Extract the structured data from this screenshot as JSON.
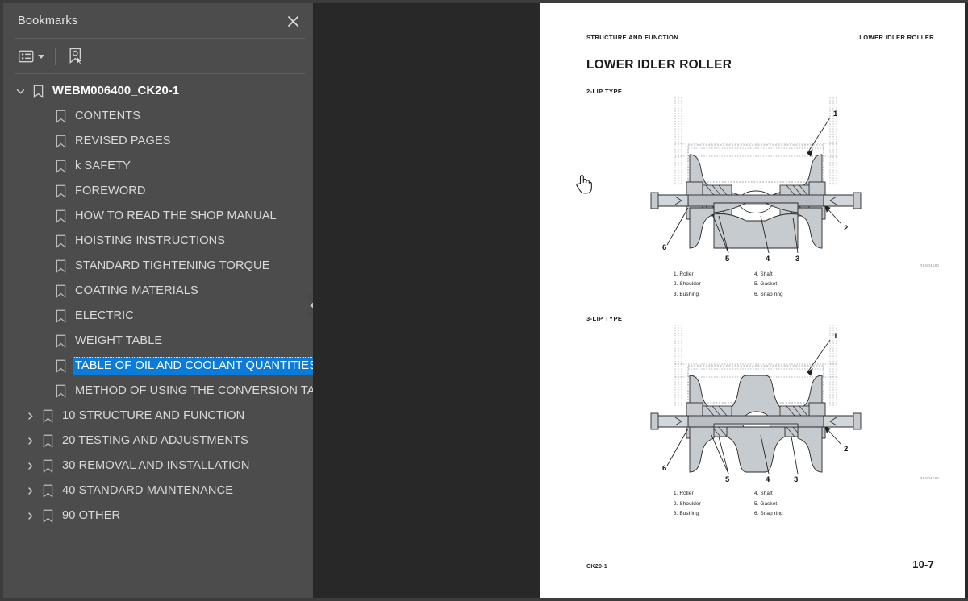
{
  "panel": {
    "title": "Bookmarks",
    "close_icon": "close-icon",
    "toolbar": {
      "options_icon": "list-options-icon",
      "options_caret": "chevron-down-icon",
      "new_bookmark_icon": "bookmark-pointer-icon"
    },
    "collapse_handle_icon": "triangle-left-icon",
    "tree": {
      "root": {
        "label": "WEBM006400_CK20-1",
        "expanded": true
      },
      "items": [
        {
          "label": "CONTENTS",
          "type": "leaf",
          "selected": false
        },
        {
          "label": "REVISED PAGES",
          "type": "leaf",
          "selected": false
        },
        {
          "label": "k SAFETY",
          "type": "leaf",
          "selected": false
        },
        {
          "label": "FOREWORD",
          "type": "leaf",
          "selected": false
        },
        {
          "label": "HOW TO READ THE SHOP MANUAL",
          "type": "leaf",
          "selected": false
        },
        {
          "label": "HOISTING INSTRUCTIONS",
          "type": "leaf",
          "selected": false
        },
        {
          "label": "STANDARD TIGHTENING TORQUE",
          "type": "leaf",
          "selected": false
        },
        {
          "label": "COATING MATERIALS",
          "type": "leaf",
          "selected": false
        },
        {
          "label": "ELECTRIC",
          "type": "leaf",
          "selected": false
        },
        {
          "label": "WEIGHT TABLE",
          "type": "leaf",
          "selected": false
        },
        {
          "label": "TABLE OF OIL AND COOLANT QUANTITIES",
          "type": "leaf",
          "selected": true
        },
        {
          "label": "METHOD OF USING THE CONVERSION TABLE",
          "type": "leaf",
          "selected": false
        },
        {
          "label": "10 STRUCTURE AND FUNCTION",
          "type": "group",
          "selected": false
        },
        {
          "label": "20 TESTING AND ADJUSTMENTS",
          "type": "group",
          "selected": false
        },
        {
          "label": "30 REMOVAL AND INSTALLATION",
          "type": "group",
          "selected": false
        },
        {
          "label": "40 STANDARD MAINTENANCE",
          "type": "group",
          "selected": false
        },
        {
          "label": "90 OTHER",
          "type": "group",
          "selected": false
        }
      ]
    }
  },
  "document": {
    "running_head_left": "STRUCTURE AND FUNCTION",
    "running_head_right": "LOWER IDLER ROLLER",
    "heading": "LOWER IDLER ROLLER",
    "figures": [
      {
        "type_label": "2-LIP TYPE",
        "drawing_code": "RKS04180",
        "callouts": [
          "1",
          "2",
          "3",
          "4",
          "5",
          "6"
        ],
        "legend_left": [
          "1. Roller",
          "2. Shoulder",
          "3. Bushing"
        ],
        "legend_right": [
          "4. Shaft",
          "5. Gasket",
          "6. Snap ring"
        ]
      },
      {
        "type_label": "3-LIP TYPE",
        "drawing_code": "RKS04190",
        "callouts": [
          "1",
          "2",
          "3",
          "4",
          "5",
          "6"
        ],
        "legend_left": [
          "1. Roller",
          "2. Shoulder",
          "3. Bushing"
        ],
        "legend_right": [
          "4. Shaft",
          "5. Gasket",
          "6. Snap ring"
        ]
      }
    ],
    "footer_left": "CK20-1",
    "footer_right": "10-7"
  },
  "colors": {
    "panel_bg": "#4c4c4c",
    "viewer_bg": "#282828",
    "selection_blue": "#0a7bd8",
    "page_white": "#ffffff"
  }
}
